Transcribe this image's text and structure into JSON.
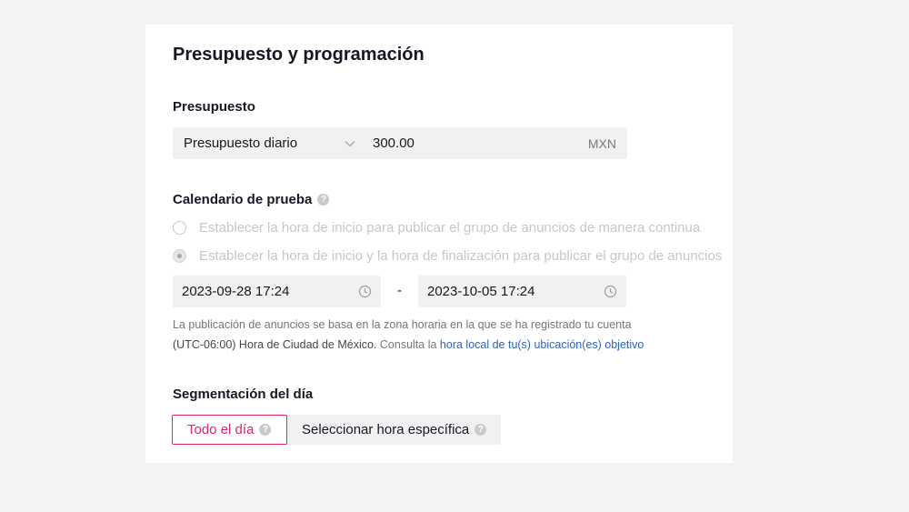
{
  "card": {
    "title": "Presupuesto y programación"
  },
  "budget": {
    "label": "Presupuesto",
    "type_selected": "Presupuesto diario",
    "amount": "300.00",
    "currency": "MXN"
  },
  "schedule": {
    "label": "Calendario de prueba",
    "options": [
      {
        "label": "Establecer la hora de inicio para publicar el grupo de anuncios de manera continua",
        "checked": false
      },
      {
        "label": "Establecer la hora de inicio y la hora de finalización para publicar el grupo de anuncios",
        "checked": true
      }
    ],
    "start_datetime": "2023-09-28 17:24",
    "end_datetime": "2023-10-05 17:24",
    "separator": "-",
    "timezone_note_prefix": "La publicación de anuncios se basa en la zona horaria en la que se ha registrado tu cuenta",
    "timezone_name": "(UTC-06:00) Hora de Ciudad de México.",
    "timezone_consult": "Consulta la",
    "timezone_link": "hora local de tu(s) ubicación(es) objetivo"
  },
  "dayparting": {
    "label": "Segmentación del día",
    "options": [
      {
        "label": "Todo el día",
        "active": true
      },
      {
        "label": "Seleccionar hora específica",
        "active": false
      }
    ]
  },
  "colors": {
    "accent": "#e0246e",
    "link": "#2e62c6"
  },
  "icons": {
    "help": "question-circle-icon",
    "dropdown": "chevron-down-icon",
    "clock": "clock-icon"
  }
}
